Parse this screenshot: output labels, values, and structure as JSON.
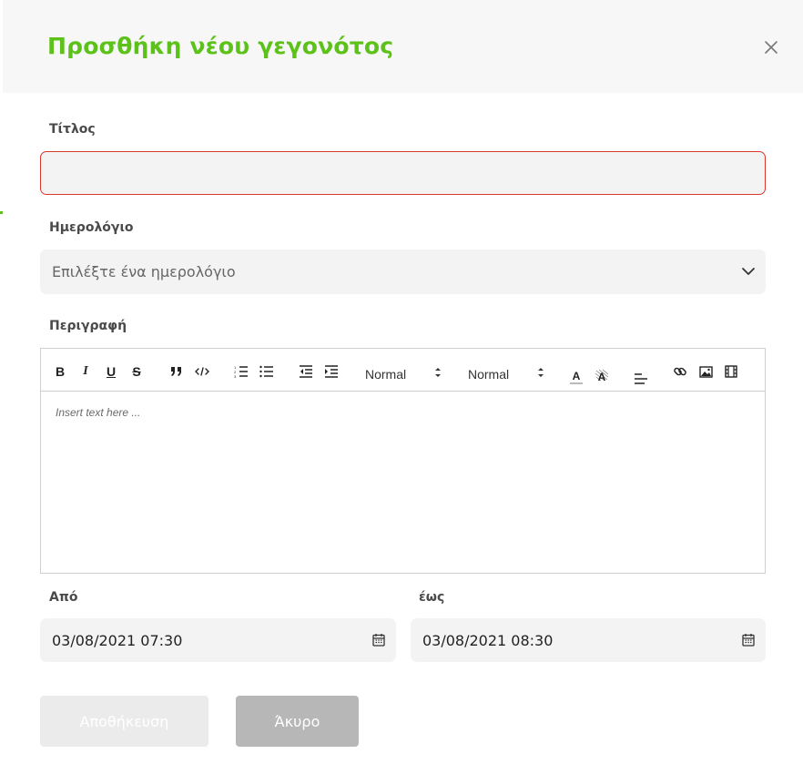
{
  "modal": {
    "title": "Προσθήκη νέου γεγονότος",
    "close_icon": "close-icon"
  },
  "form": {
    "title_label": "Τίτλος",
    "title_value": "",
    "calendar_label": "Ημερολόγιο",
    "calendar_selected": "Επιλέξτε ένα ημερολόγιο",
    "description_label": "Περιγραφή",
    "description_placeholder": "Insert text here ...",
    "from_label": "Από",
    "from_value": "03/08/2021 07:30",
    "to_label": "έως",
    "to_value": "03/08/2021 08:30"
  },
  "toolbar": {
    "bold": "B",
    "italic": "I",
    "underline": "U",
    "strike": "S",
    "size_picker": "Normal",
    "header_picker": "Normal",
    "color_letter": "A",
    "background_letter": "A"
  },
  "buttons": {
    "save": "Αποθήκευση",
    "cancel": "Άκυρο"
  },
  "colors": {
    "accent": "#5cc21a",
    "error_border": "#d9382f",
    "save_disabled": "#ebebeb",
    "cancel_bg": "#b7b7b7"
  }
}
